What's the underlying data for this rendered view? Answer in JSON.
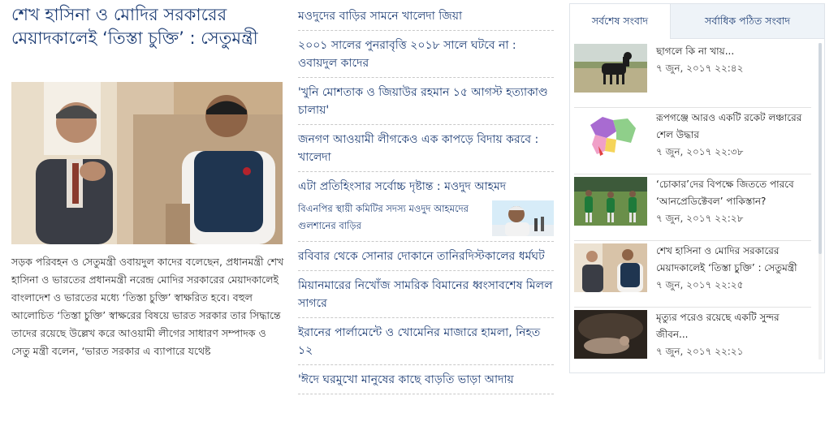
{
  "lead": {
    "title": "শেখ হাসিনা ও মোদির সরকারের মেয়াদকালেই ‘তিস্তা চুক্তি’ : সেতুমন্ত্রী",
    "summary": "সড়ক পরিবহন ও সেতুমন্ত্রী ওবায়দুল কাদের বলেছেন, প্রধানমন্ত্রী শেখ হাসিনা ও ভারতের প্রধানমন্ত্রী নরেন্দ্র মোদির সরকারের মেয়াদকালেই বাংলাদেশ ও ভারতের মধ্যে ‘তিস্তা চুক্তি’ স্বাক্ষরিত হবে। বহুল আলোচিত ‘তিস্তা চুক্তি’ স্বাক্ষরের বিষয়ে ভারত সরকার তার সিদ্ধান্তে তাদের রয়েছে উল্লেখ করে আওয়ামী লীগের সাধারণ সম্পাদক ও সেতু মন্ত্রী বলেন, ‘ভারত সরকার এ ব্যাপারে যথেষ্ট"
  },
  "middle": {
    "items": [
      "মওদুদের বাড়ির সামনে খালেদা জিয়া",
      "২০০১ সালের পুনরাবৃত্তি ২০১৮ সালে ঘটবে না : ওবায়দুল কাদের",
      "'খুনি মোশতাক ও জিয়াউর রহমান ১৫ আগস্ট হত্যাকাণ্ড চালায়'",
      "জনগণ আওয়ামী লীগকেও এক কাপড়ে বিদায় করবে : খালেদা",
      "এটা প্রতিহিংসার সর্বোচ্চ দৃষ্টান্ত : মওদুদ আহমদ"
    ],
    "sub_item": "বিএনপির স্থায়ী কমিটির সদস্য মওদুদ আহমদের গুলশানের বাড়ির",
    "items_after": [
      "রবিবার থেকে সোনার দোকানে তানিরদিস্টকালের ধর্মঘট",
      "মিয়ানমারের নিখোঁজ সামরিক বিমানের ধ্বংসাবশেষ মিলল সাগরে",
      "ইরানের পার্লামেন্টে ও খোমেনির মাজারে হামলা, নিহত ১২",
      "'ঈদে ঘরমুখো মানুষের কাছে বাড়তি ভাড়া আদায়"
    ]
  },
  "panel": {
    "tabs": {
      "latest": "সর্বশেষ সংবাদ",
      "most_read": "সর্বাধিক পঠিত সংবাদ"
    },
    "news": [
      {
        "title": "ছাগলে কি না খায়...",
        "date": "৭ জুন, ২০১৭ ২২:৪২",
        "thumb": "goat-thumbnail"
      },
      {
        "title": "রূপগঞ্জে আরও একটি রকেট লঞ্চারের শেল উদ্ধার",
        "date": "৭ জুন, ২০১৭ ২২:৩৮",
        "thumb": "map-thumbnail"
      },
      {
        "title": "‘চোকার’দের বিপক্ষে জিততে পারবে ‘আনপ্রেডিক্টেবল’ পাকিস্তান?",
        "date": "৭ জুন, ২০১৭ ২২:২৮",
        "thumb": "cricket-thumbnail"
      },
      {
        "title": "শেখ হাসিনা ও মোদির সরকারের মেয়াদকালেই ‘তিস্তা চুক্তি’ : সেতুমন্ত্রী",
        "date": "৭ জুন, ২০১৭ ২২:২৫",
        "thumb": "meeting-thumbnail"
      },
      {
        "title": "মৃত্যুর পরেও রয়েছে একটি সুন্দর জীবন...",
        "date": "৭ জুন, ২০১৭ ২২:২১",
        "thumb": "afterlife-thumbnail"
      }
    ]
  },
  "colors": {
    "headline": "#1b3b73",
    "tab_inactive_bg": "#eef3f8",
    "divider": "#c9c9c9"
  }
}
